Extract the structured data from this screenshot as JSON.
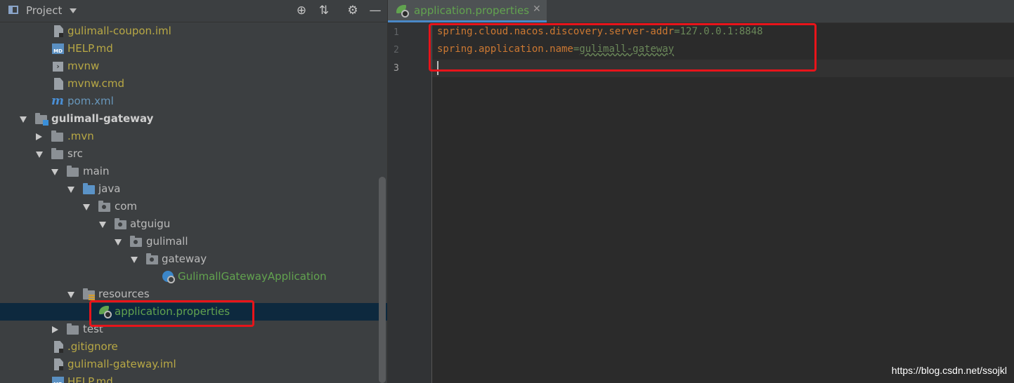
{
  "project_panel": {
    "title": "Project",
    "tree": [
      {
        "label": "gulimall-coupon.iml",
        "icon": "iml-file-icon",
        "color": "olive"
      },
      {
        "label": "HELP.md",
        "icon": "markdown-file-icon",
        "color": "olive"
      },
      {
        "label": "mvnw",
        "icon": "shell-script-icon",
        "color": "olive"
      },
      {
        "label": "mvnw.cmd",
        "icon": "text-file-icon",
        "color": "olive"
      },
      {
        "label": "pom.xml",
        "icon": "maven-icon",
        "color": "blue"
      },
      {
        "label": "gulimall-gateway",
        "icon": "module-folder-icon",
        "color": "bold",
        "expanded": true
      },
      {
        "label": ".mvn",
        "icon": "folder-icon",
        "color": "olive",
        "expanded": false
      },
      {
        "label": "src",
        "icon": "folder-icon",
        "color": "normal",
        "expanded": true
      },
      {
        "label": "main",
        "icon": "folder-icon",
        "color": "normal",
        "expanded": true
      },
      {
        "label": "java",
        "icon": "source-folder-icon",
        "color": "normal",
        "expanded": true
      },
      {
        "label": "com",
        "icon": "package-icon",
        "color": "normal",
        "expanded": true
      },
      {
        "label": "atguigu",
        "icon": "package-icon",
        "color": "normal",
        "expanded": true
      },
      {
        "label": "gulimall",
        "icon": "package-icon",
        "color": "normal",
        "expanded": true
      },
      {
        "label": "gateway",
        "icon": "package-icon",
        "color": "normal",
        "expanded": true
      },
      {
        "label": "GulimallGatewayApplication",
        "icon": "spring-boot-app-icon",
        "color": "green"
      },
      {
        "label": "resources",
        "icon": "resources-folder-icon",
        "color": "normal",
        "expanded": true
      },
      {
        "label": "application.properties",
        "icon": "spring-properties-icon",
        "color": "green",
        "selected": true
      },
      {
        "label": "test",
        "icon": "folder-icon",
        "color": "normal",
        "expanded": false
      },
      {
        "label": ".gitignore",
        "icon": "gitignore-file-icon",
        "color": "olive"
      },
      {
        "label": "gulimall-gateway.iml",
        "icon": "iml-file-icon",
        "color": "olive"
      },
      {
        "label": "HELP.md",
        "icon": "markdown-file-icon",
        "color": "olive"
      }
    ]
  },
  "editor": {
    "tab_label": "application.properties",
    "lines": [
      {
        "num": "1",
        "key": "spring.cloud.nacos.discovery.server-addr",
        "eq": "=",
        "value": "127.0.0.1:8848"
      },
      {
        "num": "2",
        "key": "spring.application.name",
        "eq": "=",
        "value": "gulimall-gateway"
      },
      {
        "num": "3",
        "key": "",
        "eq": "",
        "value": ""
      }
    ]
  },
  "watermark": "https://blog.csdn.net/ssojkl",
  "colors": {
    "highlight_box": "#e8141a",
    "selection": "#0d293e",
    "key": "#cc7832",
    "value": "#6a8759"
  }
}
